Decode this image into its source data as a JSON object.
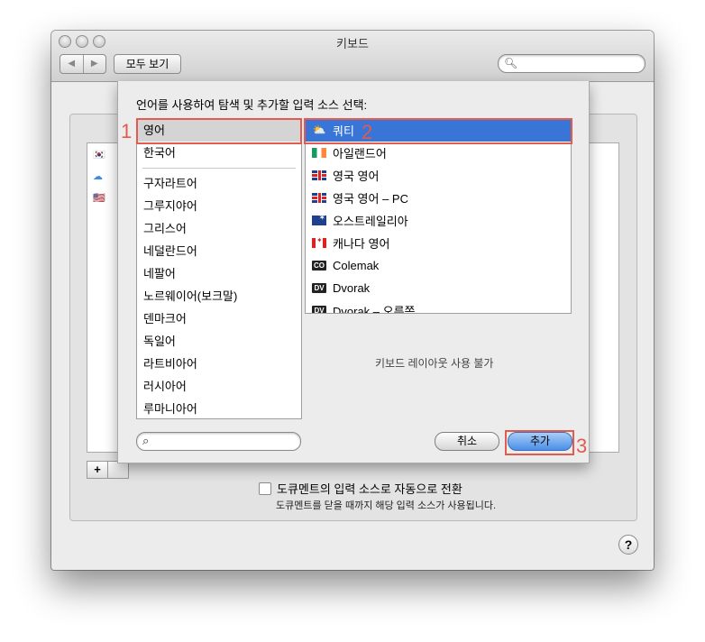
{
  "window": {
    "title": "키보드"
  },
  "toolbar": {
    "back_icon": "◀",
    "forward_icon": "▶",
    "show_all_label": "모두 보기",
    "search_placeholder": ""
  },
  "sheet": {
    "title": "언어를 사용하여 탐색 및 추가할 입력 소스 선택:",
    "languages": [
      "영어",
      "한국어",
      "구자라트어",
      "그루지야어",
      "그리스어",
      "네덜란드어",
      "네팔어",
      "노르웨이어(보크말)",
      "덴마크어",
      "독일어",
      "라트비아어",
      "러시아어",
      "루마니아어"
    ],
    "sources": [
      {
        "label": "쿼티",
        "icon": "weather-qwerty-icon"
      },
      {
        "label": "아일랜드어",
        "icon": "ireland-flag-icon"
      },
      {
        "label": "영국 영어",
        "icon": "uk-flag-icon"
      },
      {
        "label": "영국 영어 – PC",
        "icon": "uk-pc-flag-icon"
      },
      {
        "label": "오스트레일리아",
        "icon": "australia-flag-icon"
      },
      {
        "label": "캐나다 영어",
        "icon": "canada-flag-icon"
      },
      {
        "label": "Colemak",
        "icon": "colemak-badge-icon",
        "badge": "CO"
      },
      {
        "label": "Dvorak",
        "icon": "dvorak-badge-icon",
        "badge": "DV"
      },
      {
        "label": "Dvorak – 오른쪽",
        "icon": "dvorak-right-badge-icon",
        "badge": "DV"
      }
    ],
    "layout_unavailable": "키보드 레이아웃 사용 불가",
    "cancel_label": "취소",
    "add_label": "추가"
  },
  "background": {
    "auto_switch_label": "도큐멘트의 입력 소스로 자동으로 전환",
    "auto_switch_note": "도큐멘트를 닫을 때까지 해당 입력 소스가 사용됩니다.",
    "add_source_label": "+",
    "help_label": "?"
  },
  "annotations": [
    "1",
    "2",
    "3"
  ],
  "colors": {
    "annotation": "#e35a4e",
    "selection": "#3875d7"
  }
}
